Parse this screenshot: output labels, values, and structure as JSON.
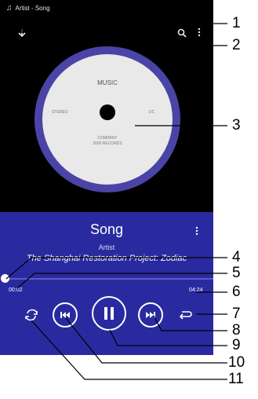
{
  "status_bar": {
    "title": "Artist - Song"
  },
  "icons": {
    "music_note": "music-note-icon",
    "back": "back-arrow-icon",
    "search": "search-icon",
    "more": "overflow-menu-icon",
    "previous": "previous-track-icon",
    "pause": "pause-icon",
    "next": "next-track-icon",
    "shuffle": "shuffle-icon",
    "repeat": "repeat-icon"
  },
  "album_art": {
    "music": "MUSIC",
    "stereo": "STEREO",
    "dc": "DC",
    "company_line1": "COMPANY",
    "company_line2": "2000 RECORDS"
  },
  "track": {
    "song": "Song",
    "artist": "Artist",
    "album": "The Shanghai Restoration Project: Zodiac"
  },
  "playback": {
    "elapsed": "00:02",
    "total": "04:24",
    "progress_fraction": 0.01
  },
  "colors": {
    "player_panel": "#2a2aa0",
    "disc_ring": "#4a44a6",
    "top_background": "#000000"
  },
  "callouts": [
    "1",
    "2",
    "3",
    "4",
    "5",
    "6",
    "7",
    "8",
    "9",
    "10",
    "11"
  ]
}
